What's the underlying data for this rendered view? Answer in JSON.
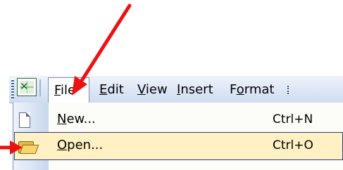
{
  "menubar": {
    "icon": "excel-icon",
    "items": [
      {
        "label": "File",
        "mnemonic": "F",
        "rest": "ile",
        "active": true
      },
      {
        "label": "Edit",
        "mnemonic": "E",
        "rest": "dit"
      },
      {
        "label": "View",
        "mnemonic": "V",
        "rest": "iew"
      },
      {
        "label": "Insert",
        "mnemonic": "I",
        "rest": "nsert"
      },
      {
        "label": "Format",
        "pre": "F",
        "mnemonic": "o",
        "rest": "rmat"
      }
    ]
  },
  "dropdown": {
    "items": [
      {
        "icon": "new-document-icon",
        "label": "New...",
        "mnemonic": "N",
        "rest": "ew...",
        "shortcut": "Ctrl+N"
      },
      {
        "icon": "open-folder-icon",
        "label": "Open...",
        "mnemonic": "O",
        "rest": "pen...",
        "shortcut": "Ctrl+O",
        "highlighted": true
      }
    ]
  },
  "annotations": {
    "arrow_color": "#ee1111",
    "arrows": [
      "arrow-to-file-menu",
      "arrow-to-open-item"
    ]
  },
  "colors": {
    "menubar_top": "#eef3fb",
    "menubar_bottom": "#cfdcf1",
    "highlight_fill": "#fff1c3",
    "highlight_border": "#2a3e7a"
  }
}
